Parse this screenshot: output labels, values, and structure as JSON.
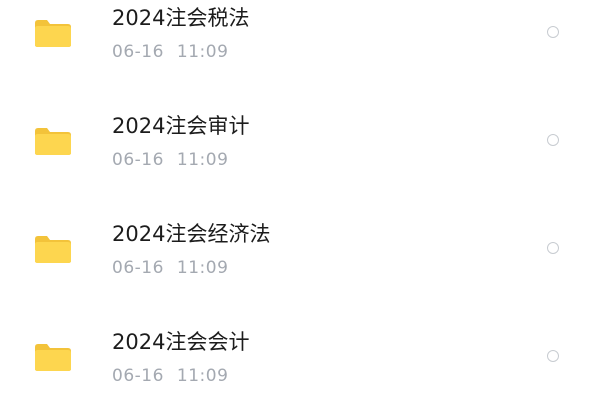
{
  "files": [
    {
      "name": "2024注会税法",
      "date": "06-16",
      "time": "11:09",
      "icon": "folder-icon"
    },
    {
      "name": "2024注会审计",
      "date": "06-16",
      "time": "11:09",
      "icon": "folder-icon"
    },
    {
      "name": "2024注会经济法",
      "date": "06-16",
      "time": "11:09",
      "icon": "folder-icon"
    },
    {
      "name": "2024注会会计",
      "date": "06-16",
      "time": "11:09",
      "icon": "folder-icon"
    }
  ],
  "colors": {
    "folder_front": "#fdd64f",
    "folder_back": "#f3c33a",
    "title_text": "#1c1c1c",
    "meta_text": "#a4a9b1",
    "radio_border": "#c8ccd1"
  }
}
